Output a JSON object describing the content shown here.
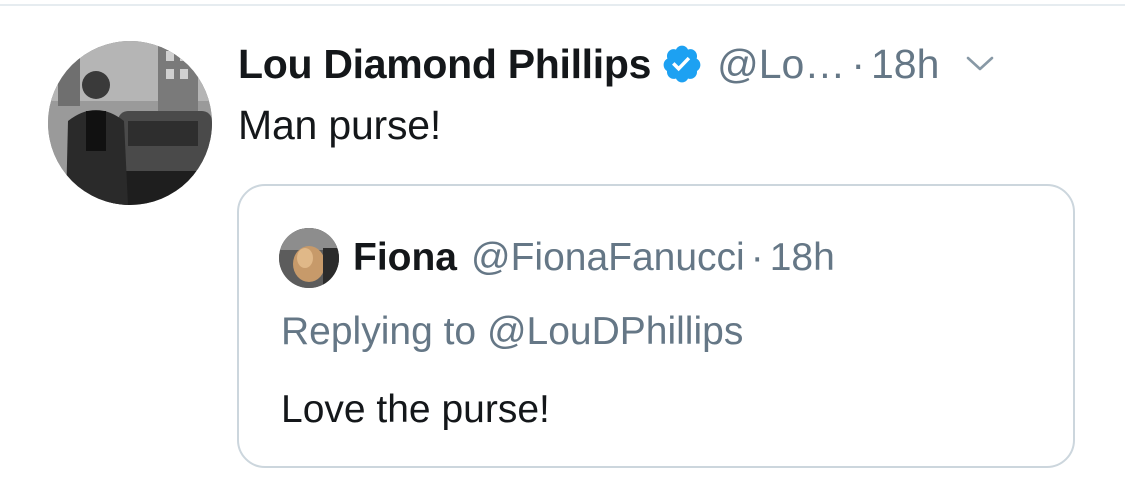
{
  "tweet": {
    "author_name": "Lou Diamond Phillips",
    "author_handle": "@Lo…",
    "separator": "·",
    "timestamp": "18h",
    "text": "Man purse!",
    "verified": true
  },
  "quoted_tweet": {
    "author_name": "Fiona",
    "author_handle": "@FionaFanucci",
    "separator": "·",
    "timestamp": "18h",
    "replying_to": "Replying to @LouDPhillips",
    "text": "Love the purse!"
  },
  "colors": {
    "text_primary": "#14171a",
    "text_secondary": "#657786",
    "verified_blue": "#1da1f2",
    "border": "#ccd6dd"
  },
  "icons": {
    "verified": "verified-badge-icon",
    "more": "chevron-down-icon"
  }
}
